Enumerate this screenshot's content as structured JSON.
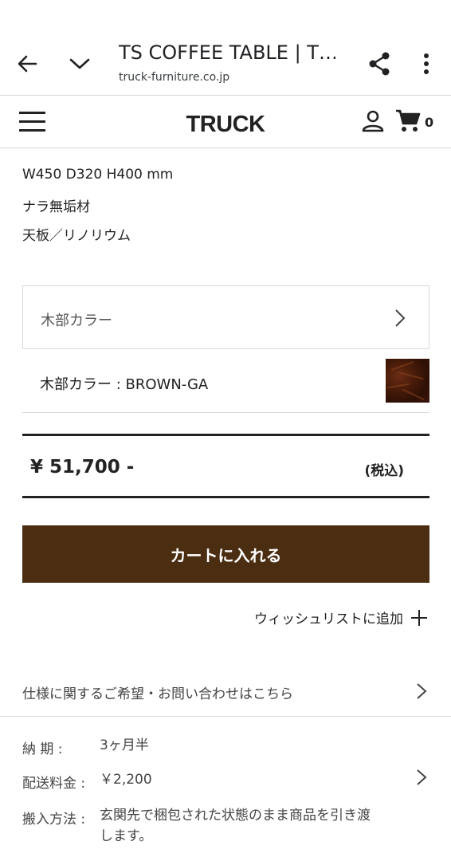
{
  "browser": {
    "title": "TS COFFEE TABLE | T…",
    "url": "truck-furniture.co.jp"
  },
  "header": {
    "logo": "TRUCK",
    "cart_count": "0"
  },
  "specs": [
    "W450 D320 H400 mm",
    "ナラ無垢材",
    "天板／リノリウム"
  ],
  "option": {
    "selector_label": "木部カラー",
    "current_label": "木部カラー : BROWN-GA",
    "swatch_color": "#3b150a"
  },
  "price": {
    "amount": "¥ 51,700 -",
    "tax_note": "(税込)"
  },
  "cart_button": {
    "label": "カートに入れる",
    "color": "#4b2e12"
  },
  "wishlist": {
    "label": "ウィッシュリストに追加"
  },
  "inquiry": {
    "label": "仕様に関するご希望・お問い合わせはこちら"
  },
  "delivery": {
    "lead_time_label": "納 期 :",
    "lead_time_value": "3ヶ月半",
    "shipping_label": "配送料金 :",
    "shipping_value": "￥2,200",
    "method_label": "搬入方法 :",
    "method_value_line1": "玄関先で梱包された状態のまま商品を引き渡",
    "method_value_line2": "します。"
  },
  "icons": {
    "back": "arrow-left-icon",
    "collapse": "chevron-down-icon",
    "share": "share-icon",
    "more": "more-vert-icon",
    "menu": "hamburger-menu-icon",
    "account": "person-icon",
    "cart": "shopping-cart-icon",
    "add": "plus-icon"
  }
}
